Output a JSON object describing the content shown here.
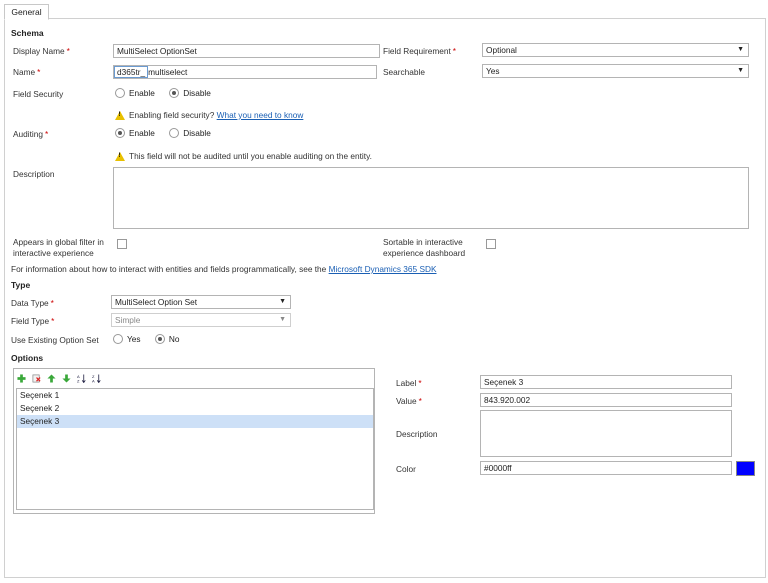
{
  "tab": {
    "label": "General"
  },
  "schema": {
    "title": "Schema",
    "display_name": {
      "label": "Display Name",
      "value": "MultiSelect OptionSet"
    },
    "name": {
      "label": "Name",
      "prefix": "d365tr_",
      "value": "multiselect"
    },
    "field_requirement": {
      "label": "Field Requirement",
      "value": "Optional"
    },
    "searchable": {
      "label": "Searchable",
      "value": "Yes"
    },
    "field_security": {
      "label": "Field Security",
      "options": [
        "Enable",
        "Disable"
      ],
      "selected": "Disable"
    },
    "security_warning": {
      "text": "Enabling field security?",
      "link": "What you need to know"
    },
    "auditing": {
      "label": "Auditing",
      "options": [
        "Enable",
        "Disable"
      ],
      "selected": "Enable"
    },
    "auditing_warning": "This field will not be audited until you enable auditing on the entity.",
    "description": {
      "label": "Description",
      "value": ""
    },
    "global_filter": {
      "label": "Appears in global filter in interactive experience",
      "checked": false
    },
    "sortable": {
      "label": "Sortable in interactive experience dashboard",
      "checked": false
    },
    "sdk_text": "For information about how to interact with entities and fields programmatically, see the",
    "sdk_link": "Microsoft Dynamics 365 SDK"
  },
  "type": {
    "title": "Type",
    "data_type": {
      "label": "Data Type",
      "value": "MultiSelect Option Set"
    },
    "field_type": {
      "label": "Field Type",
      "value": "Simple"
    },
    "use_existing": {
      "label": "Use Existing Option Set",
      "options": [
        "Yes",
        "No"
      ],
      "selected": "No"
    }
  },
  "options": {
    "title": "Options",
    "toolbar": [
      "add-icon",
      "delete-icon",
      "move-up-icon",
      "move-down-icon",
      "sort-ascending-icon",
      "sort-descending-icon"
    ],
    "items": [
      "Seçenek 1",
      "Seçenek 2",
      "Seçenek 3"
    ],
    "selected_index": 2,
    "detail": {
      "label": {
        "label": "Label",
        "value": "Seçenek 3"
      },
      "value": {
        "label": "Value",
        "value": "843.920.002"
      },
      "description": {
        "label": "Description",
        "value": ""
      },
      "color": {
        "label": "Color",
        "value": "#0000ff",
        "swatch": "#0000ff"
      }
    }
  }
}
